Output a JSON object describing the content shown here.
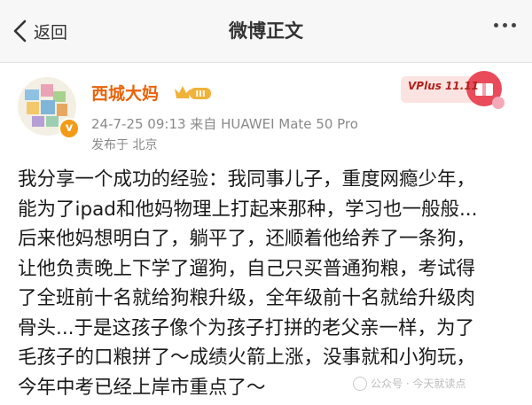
{
  "navbar": {
    "back_label": "返回",
    "title": "微博正文"
  },
  "post": {
    "user": {
      "name": "西城大妈",
      "level_badge": "III",
      "verified_mark": "v"
    },
    "meta": "24-7-25 09:13  来自 HUAWEI Mate 50 Pro",
    "location": "发布于 北京",
    "promo_badge": "VPlus 11.11",
    "content_lines": [
      "我分享一个成功的经验：我同事儿子，重度网瘾少年，",
      "能为了ipad和他妈物理上打起来那种，学习也一般般...",
      "后来他妈想明白了，躺平了，还顺着他给养了一条狗，",
      "让他负责晚上下学了遛狗，自己只买普通狗粮，考试得",
      "了全班前十名就给狗粮升级，全年级前十名就给升级肉",
      "骨头...于是这孩子像个为孩子打拼的老父亲一样，为了",
      "毛孩子的口粮拼了～成绩火箭上涨，没事就和小狗玩，",
      "今年中考已经上岸市重点了～"
    ]
  },
  "watermark": "公众号 · 今天就读点",
  "colors": {
    "username": "#e8630a",
    "meta_text": "#8a8a8a",
    "badge_orange": "#f39b16",
    "promo_red": "#b0221b"
  },
  "icons": [
    "back-arrow-icon",
    "more-dots-icon",
    "crown-level-icon",
    "verified-v-icon",
    "vplus-gift-icon"
  ]
}
